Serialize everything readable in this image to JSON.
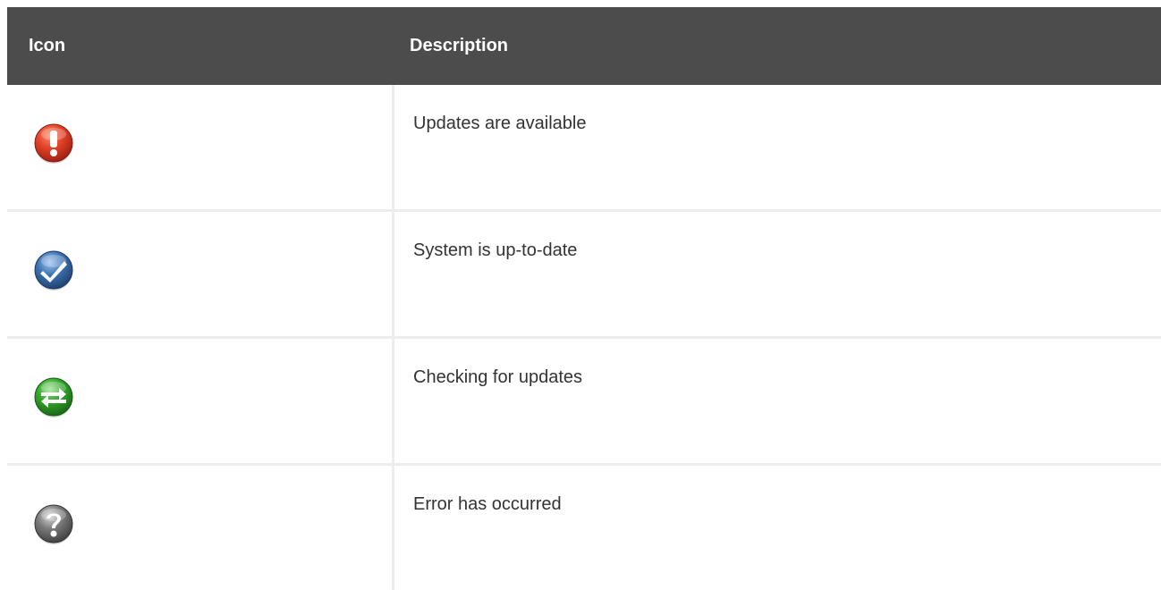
{
  "table": {
    "headers": {
      "icon": "Icon",
      "description": "Description"
    },
    "rows": [
      {
        "icon": "red-exclamation-icon",
        "description": "Updates are available"
      },
      {
        "icon": "blue-checkmark-icon",
        "description": "System is up-to-date"
      },
      {
        "icon": "green-exchange-arrows-icon",
        "description": "Checking for updates"
      },
      {
        "icon": "gray-question-mark-icon",
        "description": "Error has occurred"
      }
    ]
  },
  "colors": {
    "header_background": "#4c4c4c",
    "header_text": "#ffffff",
    "row_divider": "#ededed",
    "body_text": "#333333",
    "updates_icon": "#d63a1c",
    "uptodate_icon": "#2d5f9a",
    "checking_icon": "#2f9a2a",
    "error_icon": "#6e6e6e"
  }
}
